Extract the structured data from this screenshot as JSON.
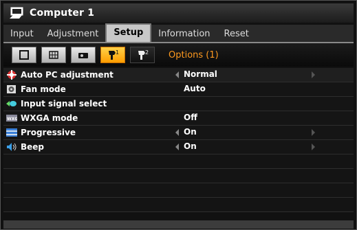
{
  "window": {
    "title": "Computer 1"
  },
  "tabs": [
    {
      "label": "Input"
    },
    {
      "label": "Adjustment"
    },
    {
      "label": "Setup",
      "active": true
    },
    {
      "label": "Information"
    },
    {
      "label": "Reset"
    }
  ],
  "subtabs": {
    "icons": [
      "screen-icon",
      "grid-icon",
      "projector-icon",
      "options1-icon",
      "options2-icon"
    ],
    "active_index": 3,
    "title": "Options (1)"
  },
  "rows": [
    {
      "label": "Auto PC adjustment",
      "value": "Normal",
      "icon": "auto-pc-icon",
      "arrows": true
    },
    {
      "label": "Fan mode",
      "value": "Auto",
      "icon": "fan-icon",
      "arrows": false
    },
    {
      "label": "Input signal select",
      "value": "",
      "icon": "input-signal-icon",
      "arrows": false
    },
    {
      "label": "WXGA mode",
      "value": "Off",
      "icon": "wxga-icon",
      "arrows": false
    },
    {
      "label": "Progressive",
      "value": "On",
      "icon": "progressive-icon",
      "arrows": true
    },
    {
      "label": "Beep",
      "value": "On",
      "icon": "beep-icon",
      "arrows": true
    }
  ],
  "colors": {
    "accent": "#ff9a1f",
    "active_tab": "#c8c8c8",
    "active_icon": "#ffb020"
  }
}
